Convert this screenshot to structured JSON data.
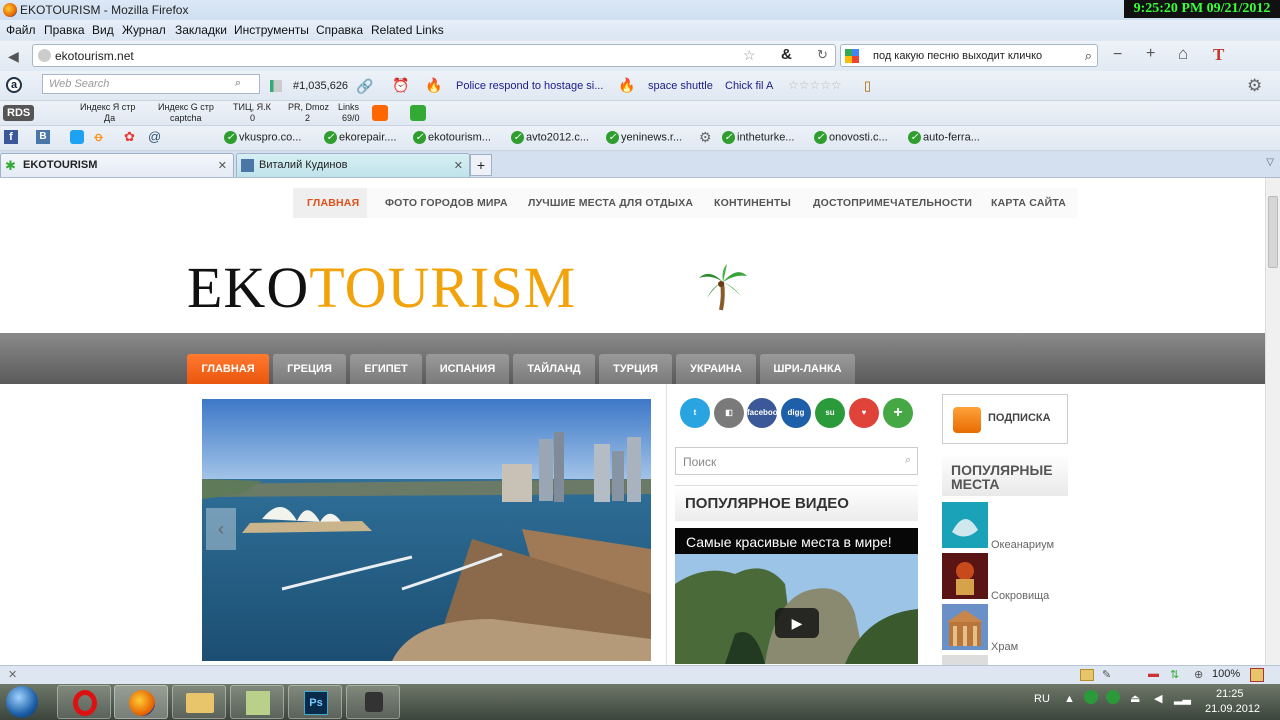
{
  "window": {
    "title": "EKOTOURISM - Mozilla Firefox",
    "clock": "9:25:20 PM 09/21/2012"
  },
  "menu": [
    "Файл",
    "Правка",
    "Вид",
    "Журнал",
    "Закладки",
    "Инструменты",
    "Справка",
    "Related Links"
  ],
  "nav": {
    "url": "ekotourism.net",
    "search_query": "под какую песню выходит кличко"
  },
  "toolbar1": {
    "web_search_placeholder": "Web Search",
    "count": "#1,035,626",
    "news1": "Police respond to hostage si...",
    "news2": "space shuttle",
    "news3": "Chick fil A"
  },
  "toolbar2": {
    "rds": "RDS",
    "yandex": "Индекс Я стр",
    "yandex_val": "Да",
    "google": "Индекс G стр",
    "google_val": "captcha",
    "tic": "ТИЦ, Я.К",
    "tic_val": "0",
    "pr": "PR, Dmoz",
    "pr_val": "2",
    "links": "Links",
    "links_val": "69/0"
  },
  "bookmarks": [
    "vkuspro.co...",
    "ekorepair....",
    "ekotourism...",
    "avto2012.c...",
    "yeninews.r...",
    "intheturke...",
    "onovosti.c...",
    "auto-ferra..."
  ],
  "tabs": [
    {
      "label": "EKOTOURISM",
      "active": true
    },
    {
      "label": "Виталий Кудинов",
      "active": false
    }
  ],
  "site": {
    "topnav": [
      "ГЛАВНАЯ",
      "ФОТО ГОРОДОВ МИРА",
      "ЛУЧШИЕ МЕСТА ДЛЯ ОТДЫХА",
      "КОНТИНЕНТЫ",
      "ДОСТОПРИМЕЧАТЕЛЬНОСТИ",
      "КАРТА САЙТА"
    ],
    "logo_dark": "EKO",
    "logo_accent": "TOURISM",
    "catnav": [
      "ГЛАВНАЯ",
      "ГРЕЦИЯ",
      "ЕГИПЕТ",
      "ИСПАНИЯ",
      "ТАЙЛАНД",
      "ТУРЦИЯ",
      "УКРАИНА",
      "ШРИ-ЛАНКА"
    ],
    "social": [
      "facebook",
      "digg"
    ],
    "search_placeholder": "Поиск",
    "popular_video": "ПОПУЛЯРНОЕ ВИДЕО",
    "video_title": "Самые красивые места в мире!",
    "subscribe": "ПОДПИСКА",
    "popular_places_1": "ПОПУЛЯРНЫЕ",
    "popular_places_2": "МЕСТА",
    "places": [
      "Океанариум",
      "Сокровища",
      "Храм"
    ]
  },
  "status": {
    "zoom": "100%"
  },
  "taskbar": {
    "lang": "RU",
    "time": "21:25",
    "date": "21.09.2012"
  }
}
